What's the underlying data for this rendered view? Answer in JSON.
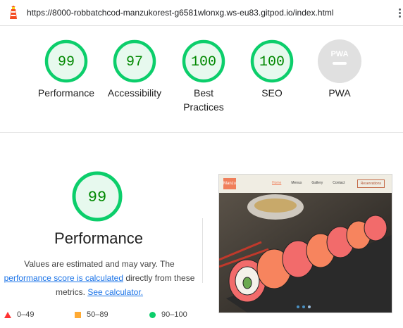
{
  "url": "https://8000-robbatchcod-manzukorest-g6581wlonxg.ws-eu83.gitpod.io/index.html",
  "colors": {
    "pass": "#0cce6b",
    "pass_text": "#008800",
    "pass_bg": "#e7f9ee",
    "na": "#e0e0e0",
    "link": "#1a73e8"
  },
  "scores": [
    {
      "value": "99",
      "label": "Performance"
    },
    {
      "value": "97",
      "label": "Accessibility"
    },
    {
      "value": "100",
      "label": "Best Practices"
    },
    {
      "value": "100",
      "label": "SEO"
    }
  ],
  "pwa": {
    "badge_text": "PWA",
    "label": "PWA"
  },
  "performance": {
    "score": "99",
    "title": "Performance",
    "desc_1": "Values are estimated and may vary. The",
    "desc_link_1": "performance score is calculated",
    "desc_2": "directly from these metrics.",
    "desc_link_2": "See calculator."
  },
  "legend": [
    {
      "icon": "triangle-red",
      "range": "0–49"
    },
    {
      "icon": "square-orange",
      "range": "50–89"
    },
    {
      "icon": "circle-green",
      "range": "90–100"
    }
  ],
  "thumbnail": {
    "logo": "Manzu",
    "nav": [
      "Home",
      "Menus",
      "Gallery",
      "Contact"
    ],
    "reserve": "Reservations"
  }
}
